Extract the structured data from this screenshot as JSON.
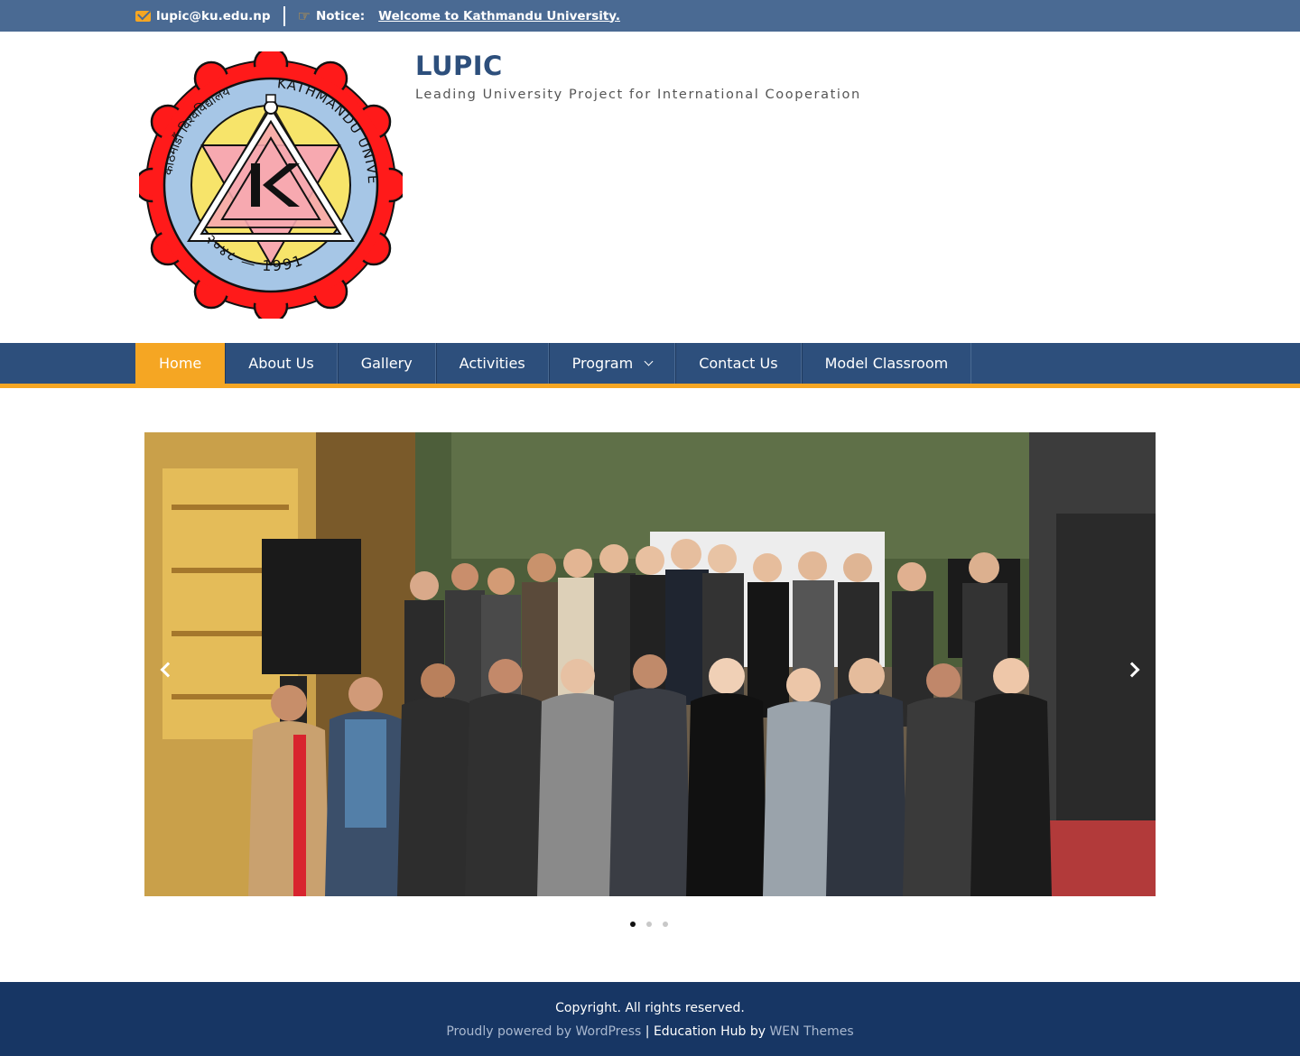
{
  "topbar": {
    "email": "lupic@ku.edu.np",
    "notice_label": "Notice:",
    "notice_text": "Welcome to Kathmandu University."
  },
  "header": {
    "title": "LUPIC",
    "tagline": "Leading University Project for International Cooperation",
    "logo": {
      "ring_text": "KATHMANDU UNIVERSITY",
      "devanagari_text": "काठमाडौं विश्वविद्यालय",
      "years": "२०४८ — 1991",
      "center_letter": "K"
    }
  },
  "nav": {
    "items": [
      {
        "label": "Home",
        "active": true
      },
      {
        "label": "About Us"
      },
      {
        "label": "Gallery"
      },
      {
        "label": "Activities"
      },
      {
        "label": "Program",
        "has_submenu": true
      },
      {
        "label": "Contact Us"
      },
      {
        "label": "Model Classroom"
      }
    ]
  },
  "slider": {
    "slide_count": 3,
    "active_index": 0
  },
  "footer": {
    "copyright": "Copyright. All rights reserved.",
    "powered_by": "Proudly powered by WordPress",
    "separator": " | ",
    "theme": "Education Hub",
    "by": " by ",
    "author": "WEN Themes"
  },
  "colors": {
    "topbar": "#4a6a93",
    "nav": "#2d4f7c",
    "accent": "#f5a623",
    "footer": "#173664"
  }
}
